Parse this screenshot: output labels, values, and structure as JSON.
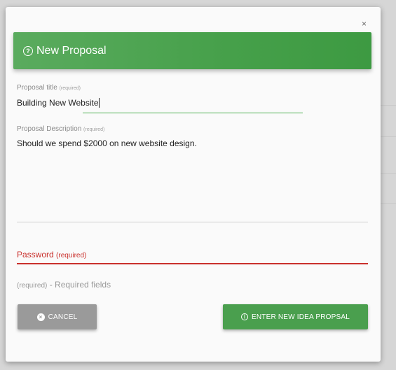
{
  "modal": {
    "close_label": "×",
    "header": {
      "icon": "question-circle-icon",
      "title": "New Proposal",
      "color": "#4caf50"
    },
    "fields": {
      "title": {
        "label": "Proposal title",
        "required": "(required)",
        "value": "Building New Website"
      },
      "description": {
        "label": "Proposal Description",
        "required": "(required)",
        "value": "Should we spend $2000 on new website design."
      },
      "password": {
        "label": "Password",
        "required": "(required)",
        "error_color": "#c9302c"
      }
    },
    "helper": {
      "required": "(required)",
      "text": " - Required fields"
    },
    "buttons": {
      "cancel": {
        "icon": "close-circle-icon",
        "label": "CANCEL"
      },
      "enter": {
        "icon": "power-icon",
        "label": "ENTER NEW IDEA PROPSAL"
      }
    }
  }
}
